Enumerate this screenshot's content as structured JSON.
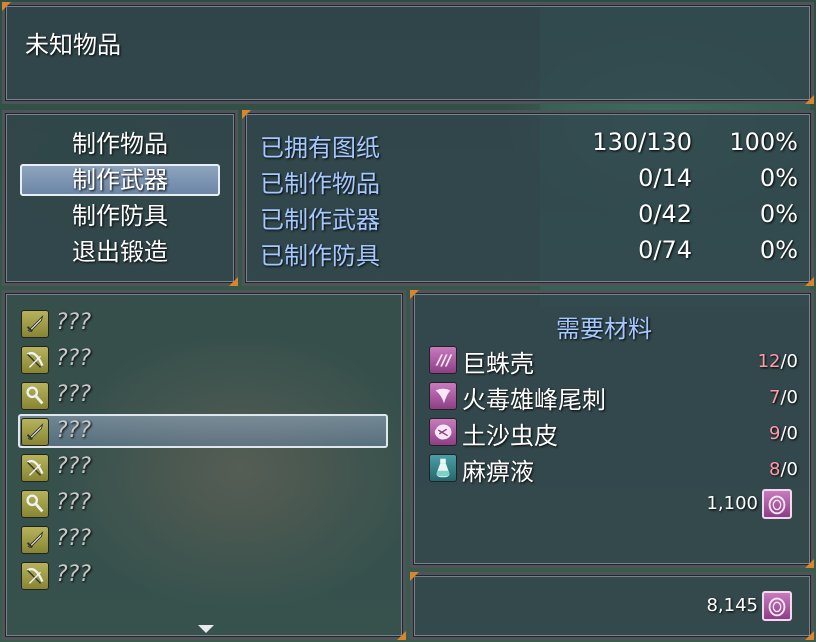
{
  "title": "未知物品",
  "commands": [
    {
      "label": "制作物品"
    },
    {
      "label": "制作武器"
    },
    {
      "label": "制作防具"
    },
    {
      "label": "退出锻造"
    }
  ],
  "stats": [
    {
      "label": "已拥有图纸",
      "value": "130/130",
      "pct": "100%"
    },
    {
      "label": "已制作物品",
      "value": "0/14",
      "pct": "0%"
    },
    {
      "label": "已制作武器",
      "value": "0/42",
      "pct": "0%"
    },
    {
      "label": "已制作防具",
      "value": "0/74",
      "pct": "0%"
    }
  ],
  "recipes": [
    {
      "icon": "sword-icon",
      "name": "???"
    },
    {
      "icon": "bow-icon",
      "name": "???"
    },
    {
      "icon": "staff-icon",
      "name": "???"
    },
    {
      "icon": "sword-icon",
      "name": "???"
    },
    {
      "icon": "bow-icon",
      "name": "???"
    },
    {
      "icon": "staff-icon",
      "name": "???"
    },
    {
      "icon": "sword-icon",
      "name": "???"
    },
    {
      "icon": "bow-icon",
      "name": "???"
    }
  ],
  "materials": {
    "heading": "需要材料",
    "items": [
      {
        "icon": "carapace-icon",
        "name": "巨蛛壳",
        "need": "12",
        "have": "/0"
      },
      {
        "icon": "stinger-icon",
        "name": "火毒雄峰尾刺",
        "need": "7",
        "have": "/0"
      },
      {
        "icon": "hide-icon",
        "name": "土沙虫皮",
        "need": "9",
        "have": "/0"
      },
      {
        "icon": "potion-icon",
        "name": "麻痹液",
        "need": "8",
        "have": "/0"
      }
    ],
    "cost": "1,100"
  },
  "gold": "8,145",
  "colors": {
    "accent": "#d7862d",
    "blue_text": "#a4c8ff",
    "need_red": "#ff9aa8"
  }
}
